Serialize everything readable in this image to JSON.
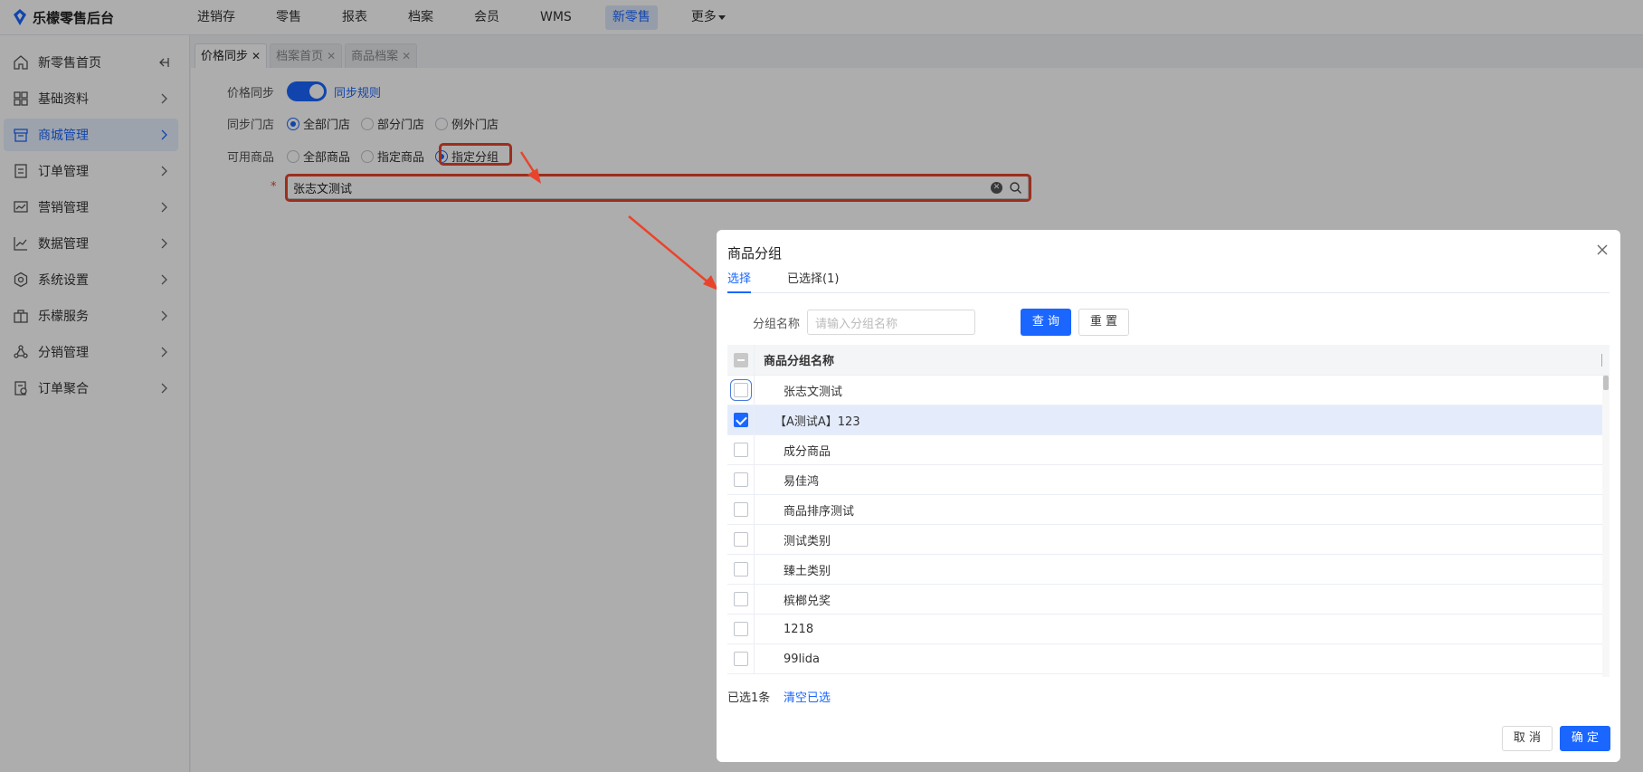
{
  "app": {
    "logo_text": "乐檬零售后台"
  },
  "topnav": {
    "items": [
      {
        "label": "进销存",
        "active": false
      },
      {
        "label": "零售",
        "active": false
      },
      {
        "label": "报表",
        "active": false
      },
      {
        "label": "档案",
        "active": false
      },
      {
        "label": "会员",
        "active": false
      },
      {
        "label": "WMS",
        "active": false
      },
      {
        "label": "新零售",
        "active": true
      },
      {
        "label": "更多",
        "active": false
      }
    ]
  },
  "sidebar": {
    "items": [
      {
        "label": "新零售首页",
        "icon": "home-icon"
      },
      {
        "label": "基础资料",
        "icon": "grid-icon"
      },
      {
        "label": "商城管理",
        "icon": "store-icon",
        "active": true
      },
      {
        "label": "订单管理",
        "icon": "order-icon"
      },
      {
        "label": "营销管理",
        "icon": "marketing-icon"
      },
      {
        "label": "数据管理",
        "icon": "chart-icon"
      },
      {
        "label": "系统设置",
        "icon": "settings-icon"
      },
      {
        "label": "乐檬服务",
        "icon": "service-icon"
      },
      {
        "label": "分销管理",
        "icon": "distribution-icon"
      },
      {
        "label": "订单聚合",
        "icon": "aggregate-icon"
      }
    ]
  },
  "tabs": [
    {
      "label": "价格同步",
      "active": true
    },
    {
      "label": "档案首页",
      "active": false
    },
    {
      "label": "商品档案",
      "active": false
    }
  ],
  "form": {
    "price_sync": {
      "label": "价格同步",
      "enabled": true,
      "rule_link": "同步规则"
    },
    "sync_store": {
      "label": "同步门店",
      "options": [
        "全部门店",
        "部分门店",
        "例外门店"
      ],
      "selected": "全部门店"
    },
    "available_goods": {
      "label": "可用商品",
      "options": [
        "全部商品",
        "指定商品",
        "指定分组"
      ],
      "selected": "指定分组"
    },
    "group_field": {
      "required_mark": "*",
      "value": "张志文测试"
    }
  },
  "modal": {
    "title": "商品分组",
    "tabs": [
      {
        "label": "选择",
        "active": true
      },
      {
        "label": "已选择(1)",
        "active": false
      }
    ],
    "filter": {
      "label": "分组名称",
      "placeholder": "请输入分组名称",
      "query_button": "查 询",
      "reset_button": "重 置"
    },
    "table": {
      "header": "商品分组名称",
      "rows": [
        {
          "name": "张志文测试",
          "checked": false
        },
        {
          "name": "【A测试A】123",
          "checked": true
        },
        {
          "name": "成分商品",
          "checked": false
        },
        {
          "name": "易佳鸿",
          "checked": false
        },
        {
          "name": "商品排序测试",
          "checked": false
        },
        {
          "name": "测试类别",
          "checked": false
        },
        {
          "name": "臻土类别",
          "checked": false
        },
        {
          "name": "槟榔兑奖",
          "checked": false
        },
        {
          "name": "1218",
          "checked": false
        },
        {
          "name": "99lida",
          "checked": false
        }
      ]
    },
    "footer": {
      "selected_count": "已选1条",
      "clear_link": "清空已选",
      "cancel_button": "取 消",
      "ok_button": "确 定"
    }
  },
  "colors": {
    "accent": "#1a66ff",
    "highlight": "#e8442c"
  }
}
